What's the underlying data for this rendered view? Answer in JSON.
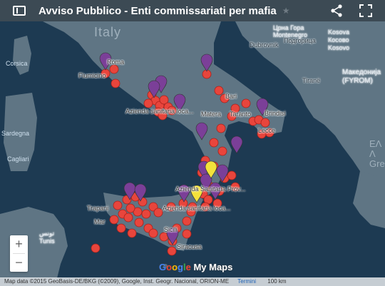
{
  "header": {
    "title": "Avviso Pubblico - Enti commissariati per mafia",
    "menu_icon": "sidebar-toggle-icon",
    "star_icon": "star-icon",
    "share_icon": "share-icon",
    "fullscreen_icon": "fullscreen-icon",
    "background": "#3c4a54"
  },
  "map": {
    "water_color": "#1d3a52",
    "land_color": "#5f7584",
    "marker_red": "#e8453c",
    "marker_purple": "#7b3f98",
    "marker_yellow": "#f3e23b",
    "labels": {
      "italy": "Italy",
      "roma": "Roma",
      "fiumicino": "Fiumicino",
      "corsica": "Corsica",
      "sardegna": "Sardegna",
      "cagliari": "Cagliari",
      "bari": "Bari",
      "matera": "Matera",
      "taranto": "Taranto",
      "brindisi": "Brindisi",
      "lecce": "Lecce",
      "dubrovnik": "Dubrovnik",
      "podgorica": "Подгорица",
      "montenegro": "Црна Гора\nMontenegro",
      "kosovo": "Kosova\nКосово\nKosovo",
      "tirane": "Tiranë",
      "macedonia": "Македонија\n(FYROM)",
      "greece": "ΕΛ\nΛ\nGre",
      "trapani": "Trapani",
      "marsala": "Mar",
      "sicilia": "Sicili",
      "siracusa": "Siracusa",
      "tunis": "تونس\nTunis",
      "pin_azienda_1": "Azienda sanitaria loca...",
      "pin_azienda_2": "Azienda Sanitaria Prov...",
      "pin_azienda_3": "Azienda sanitaria loca..."
    }
  },
  "zoom": {
    "in": "+",
    "out": "−"
  },
  "branding": {
    "g": "G",
    "o1": "o",
    "o2": "o",
    "g2": "g",
    "l": "l",
    "e": "e",
    "mymaps": " My Maps"
  },
  "attribution": {
    "text": "Map data ©2015 GeoBasis-DE/BKG (©2009), Google, Inst. Geogr. Nacional, ORION-ME",
    "terms": "Termini",
    "scale": "100 km"
  }
}
